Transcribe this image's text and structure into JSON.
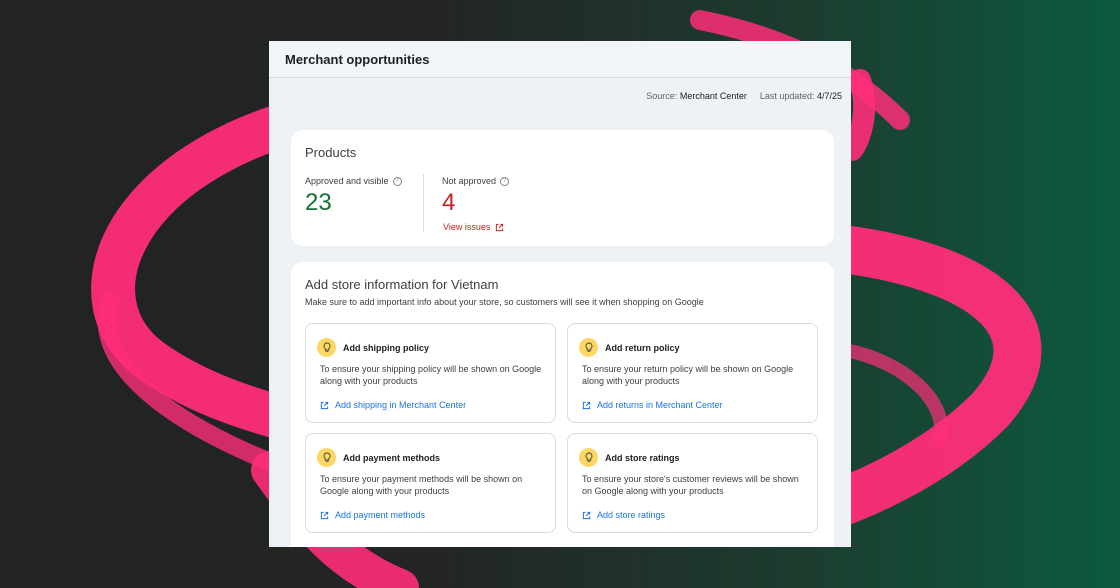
{
  "panel": {
    "title": "Merchant opportunities",
    "source_label": "Source:",
    "source_value": "Merchant Center",
    "updated_label": "Last updated:",
    "updated_value": "4/7/25"
  },
  "products": {
    "title": "Products",
    "approved_label": "Approved and visible",
    "approved_value": "23",
    "not_approved_label": "Not approved",
    "not_approved_value": "4",
    "view_issues_label": "View issues"
  },
  "store": {
    "title": "Add store information for Vietnam",
    "subtitle": "Make sure to add important info about your store, so customers will see it when shopping on Google",
    "tiles": [
      {
        "title": "Add shipping policy",
        "description": "To ensure your shipping policy will be shown on Google along with your products",
        "link": "Add shipping in Merchant Center"
      },
      {
        "title": "Add return policy",
        "description": "To ensure your return policy will be shown on Google along with your products",
        "link": "Add returns in Merchant Center"
      },
      {
        "title": "Add payment methods",
        "description": "To ensure your payment methods will be shown on Google along with your products",
        "link": "Add payment methods"
      },
      {
        "title": "Add store ratings",
        "description": "To ensure your store's customer reviews will be shown on Google along with your products",
        "link": "Add store ratings"
      }
    ]
  },
  "colors": {
    "approved": "#137333",
    "not_approved": "#c5221f",
    "link": "#1a73e8",
    "bulb": "#fdd663",
    "swoosh": "#ff2d7a"
  },
  "icons": {
    "help": "help-circle-icon",
    "external": "external-link-icon",
    "bulb": "lightbulb-icon"
  }
}
